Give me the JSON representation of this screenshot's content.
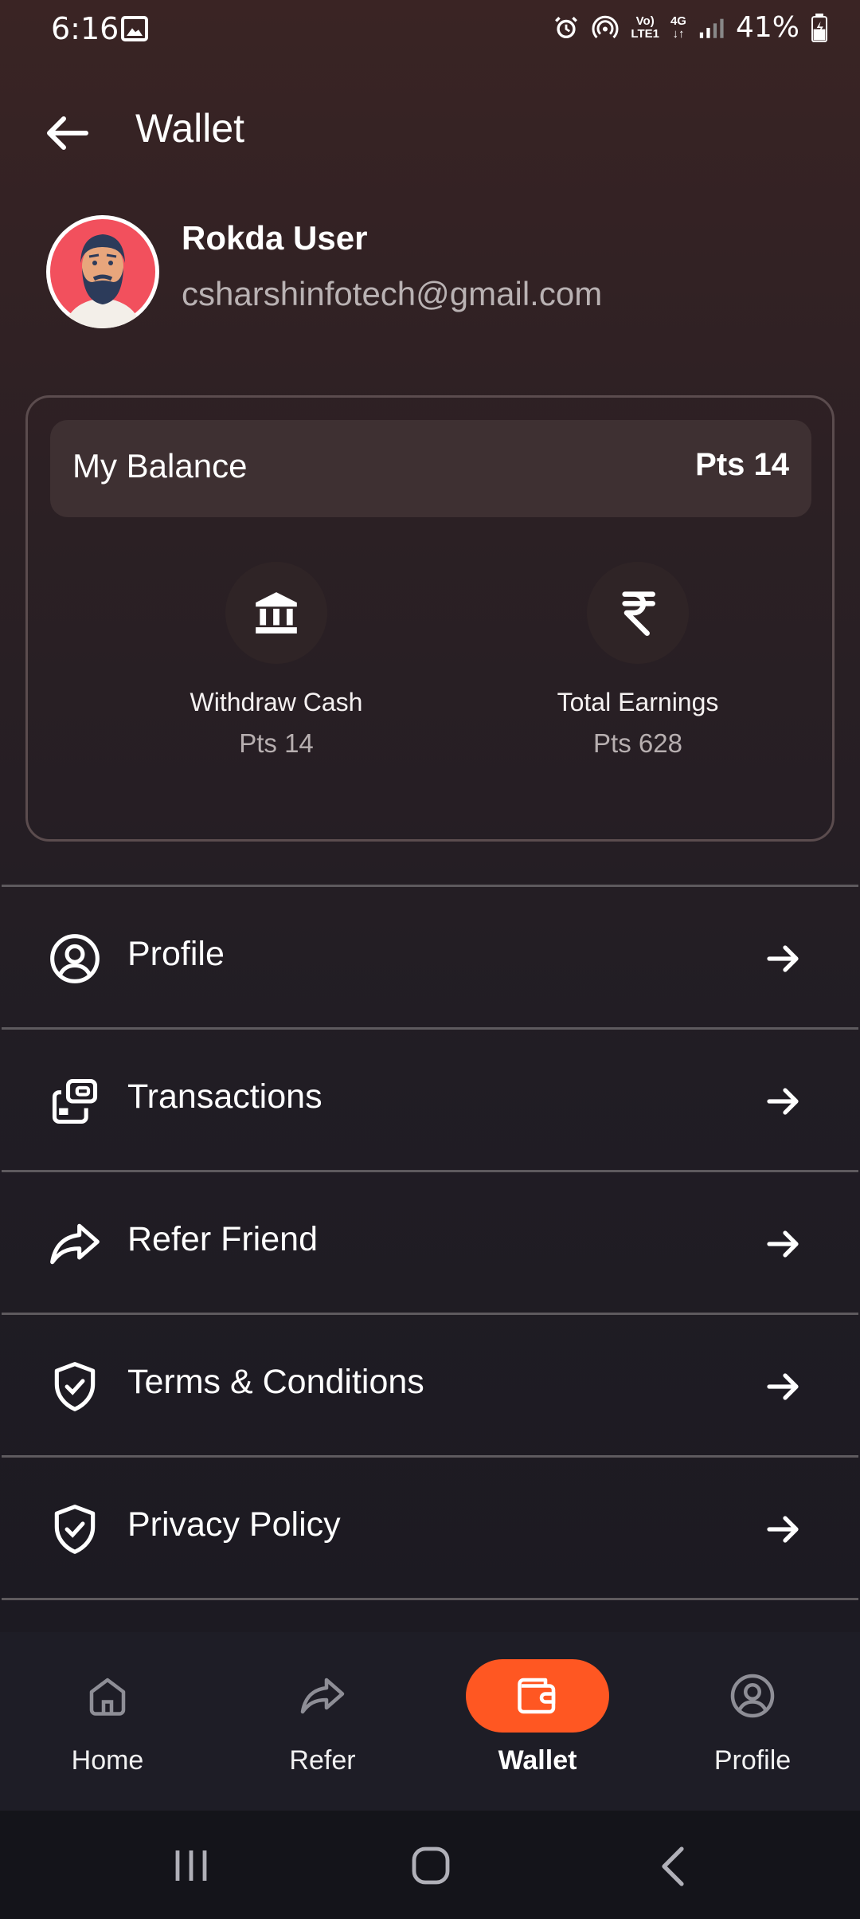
{
  "status_bar": {
    "time": "6:16",
    "network_line1": "Vo)",
    "network_line2": "LTE1",
    "network_type_1": "4G",
    "network_type_2": "↓↑",
    "battery": "41%",
    "icons": [
      "gallery-icon",
      "alarm-icon",
      "hotspot-icon",
      "signal-icon",
      "battery-icon"
    ]
  },
  "header": {
    "title": "Wallet"
  },
  "user": {
    "name": "Rokda User",
    "email": "csharshinfotech@gmail.com"
  },
  "balance_card": {
    "label": "My Balance",
    "value": "Pts 14",
    "withdraw": {
      "label": "Withdraw Cash",
      "value": "Pts 14",
      "icon": "bank-icon"
    },
    "earnings": {
      "label": "Total Earnings",
      "value": "Pts 628",
      "icon": "rupee-icon"
    }
  },
  "menu": {
    "items": [
      {
        "label": "Profile",
        "icon": "user-circle-icon"
      },
      {
        "label": "Transactions",
        "icon": "transactions-icon"
      },
      {
        "label": "Refer Friend",
        "icon": "share-icon"
      },
      {
        "label": "Terms & Conditions",
        "icon": "shield-check-icon"
      },
      {
        "label": "Privacy Policy",
        "icon": "shield-check-icon"
      }
    ]
  },
  "bottom_nav": {
    "items": [
      {
        "label": "Home",
        "icon": "home-icon"
      },
      {
        "label": "Refer",
        "icon": "share-icon"
      },
      {
        "label": "Wallet",
        "icon": "wallet-icon",
        "active": true
      },
      {
        "label": "Profile",
        "icon": "user-circle-icon"
      }
    ],
    "active_color": "#ff5722"
  },
  "colors": {
    "background_top": "#3a2424",
    "background_bottom": "#16151b",
    "accent": "#ff5722",
    "muted_text": "#b9b2b3"
  }
}
